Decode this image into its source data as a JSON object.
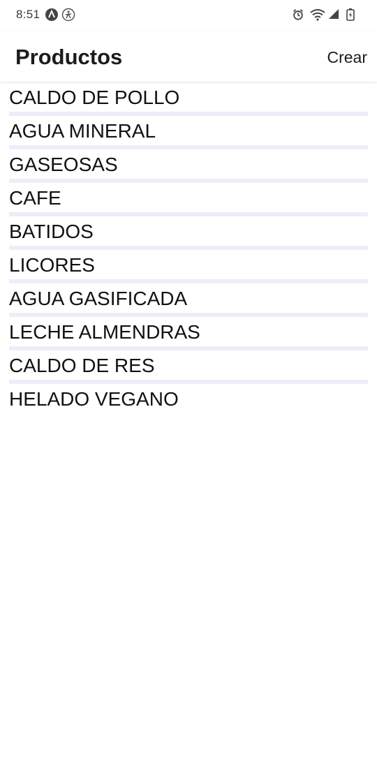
{
  "status_bar": {
    "time": "8:51",
    "left_icons": [
      "app-a-icon",
      "accessibility-icon"
    ],
    "right_icons": [
      "alarm-icon",
      "wifi-icon",
      "signal-icon",
      "battery-icon"
    ]
  },
  "header": {
    "title": "Productos",
    "create_label": "Crear"
  },
  "products": [
    {
      "label": "CALDO DE POLLO"
    },
    {
      "label": "AGUA MINERAL"
    },
    {
      "label": "GASEOSAS"
    },
    {
      "label": "CAFE"
    },
    {
      "label": "BATIDOS"
    },
    {
      "label": "LICORES"
    },
    {
      "label": "AGUA GASIFICADA"
    },
    {
      "label": "LECHE ALMENDRAS"
    },
    {
      "label": "CALDO DE RES"
    },
    {
      "label": "HELADO VEGANO"
    }
  ],
  "colors": {
    "separator": "#ededfa",
    "text": "#111111",
    "background": "#ffffff"
  }
}
